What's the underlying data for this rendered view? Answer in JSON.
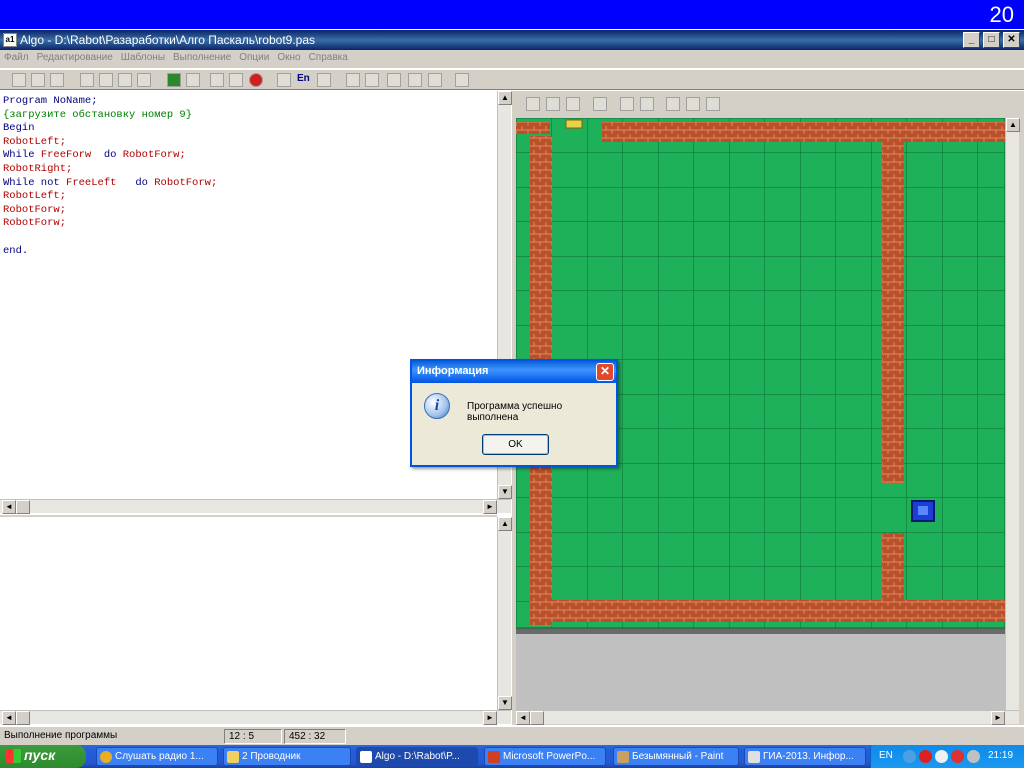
{
  "slide": {
    "number": "20"
  },
  "window": {
    "icon_label": "a1",
    "title": "Algo - D:\\Rabot\\Разаработки\\Алго Паскаль\\robot9.pas",
    "min": "_",
    "max": "□",
    "close": "✕"
  },
  "menu": [
    "Файл",
    "Редактирование",
    "Шаблоны",
    "Выполнение",
    "Опции",
    "Окно",
    "Справка"
  ],
  "toolbar": {
    "lang": "En"
  },
  "code": [
    {
      "cls": "kw",
      "text": "Program NoName;"
    },
    {
      "cls": "cm",
      "text": "{загрузите обстановку номер 9}"
    },
    {
      "cls": "kw",
      "text": "Begin"
    },
    {
      "cls": "fn",
      "text": "RobotLeft;"
    },
    {
      "mixed": [
        [
          "kw",
          "While "
        ],
        [
          "fn",
          "FreeForw  "
        ],
        [
          "kw",
          "do "
        ],
        [
          "fn",
          "RobotForw;"
        ]
      ]
    },
    {
      "cls": "fn",
      "text": "RobotRight;"
    },
    {
      "mixed": [
        [
          "kw",
          "While not "
        ],
        [
          "fn",
          "FreeLeft   "
        ],
        [
          "kw",
          "do "
        ],
        [
          "fn",
          "RobotForw;"
        ]
      ]
    },
    {
      "cls": "fn",
      "text": "RobotLeft;"
    },
    {
      "cls": "fn",
      "text": "RobotForw;"
    },
    {
      "cls": "fn",
      "text": "RobotForw;"
    },
    {
      "cls": "kw",
      "text": ""
    },
    {
      "cls": "kw",
      "text": "end."
    }
  ],
  "dialog": {
    "title": "Информация",
    "close": "✕",
    "icon": "i",
    "message": "Программа успешно выполнена",
    "ok": "OK"
  },
  "status": {
    "text": "Выполнение программы",
    "cursor": "12 :  5",
    "size": "452 : 32"
  },
  "taskbar": {
    "start": "пуск",
    "items": [
      {
        "label": "Слушать радио 1...",
        "active": false
      },
      {
        "label": "2 Проводник",
        "active": false
      },
      {
        "label": "Algo - D:\\Rabot\\P...",
        "active": true
      },
      {
        "label": "Microsoft PowerPo...",
        "active": false
      },
      {
        "label": "Безымянный - Paint",
        "active": false
      },
      {
        "label": "ГИА-2013. Инфор...",
        "active": false
      }
    ],
    "lang": "EN",
    "time": "21:19"
  },
  "colors": {
    "grass": "#1fb05a",
    "wall": "#b04a2a",
    "robot": "#1a3fd6"
  }
}
